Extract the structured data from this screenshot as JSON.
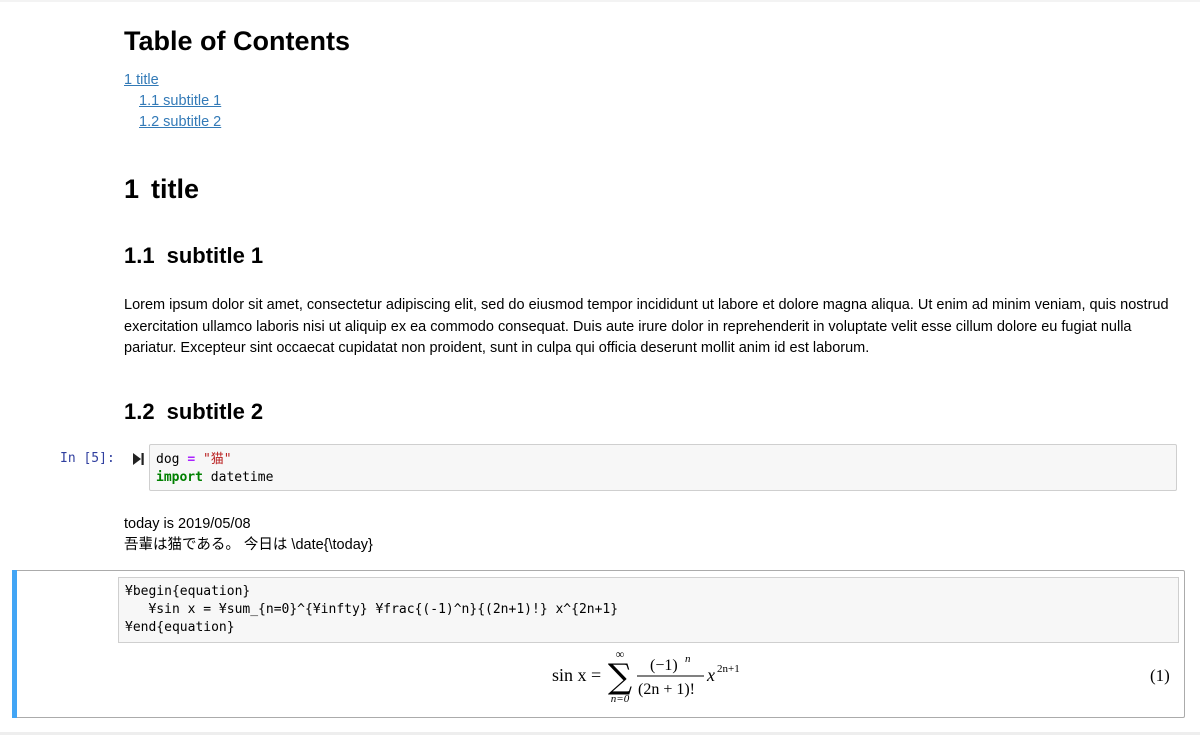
{
  "toc": {
    "title": "Table of Contents",
    "items": [
      {
        "label": "1  title"
      },
      {
        "label": "1.1  subtitle 1"
      },
      {
        "label": "1.2  subtitle 2"
      }
    ]
  },
  "sections": {
    "h1": {
      "num": "1",
      "text": "title"
    },
    "h2a": {
      "num": "1.1",
      "text": "subtitle 1"
    },
    "h2b": {
      "num": "1.2",
      "text": "subtitle 2"
    }
  },
  "lorem": "Lorem ipsum dolor sit amet, consectetur adipiscing elit, sed do eiusmod tempor incididunt ut labore et dolore magna aliqua. Ut enim ad minim veniam, quis nostrud exercitation ullamco laboris nisi ut aliquip ex ea commodo consequat. Duis aute irure dolor in reprehenderit in voluptate velit esse cillum dolore eu fugiat nulla pariatur. Excepteur sint occaecat cupidatat non proident, sunt in culpa qui officia deserunt mollit anim id est laborum.",
  "code_cell": {
    "prompt": "In [5]:",
    "line1": {
      "var": "dog ",
      "op": "=",
      "str": " \"猫\""
    },
    "line2": {
      "kw": "import",
      "rest": " datetime"
    }
  },
  "outputs": {
    "line1": "today is 2019/05/08",
    "line2": "吾輩は猫である。 今日は \\date{\\today}"
  },
  "tex_source": {
    "line1": "¥begin{equation}",
    "line2": "   ¥sin x = ¥sum_{n=0}^{¥infty} ¥frac{(-1)^n}{(2n+1)!} x^{2n+1}",
    "line3": "¥end{equation}"
  },
  "equation": {
    "lhs": "sin x =",
    "sum_upper": "∞",
    "sum_lower": "n=0",
    "numerator": "(−1)",
    "numerator_exp": "n",
    "denominator": "(2n + 1)!",
    "x": "x",
    "x_exp": "2n+1",
    "number": "(1)"
  }
}
